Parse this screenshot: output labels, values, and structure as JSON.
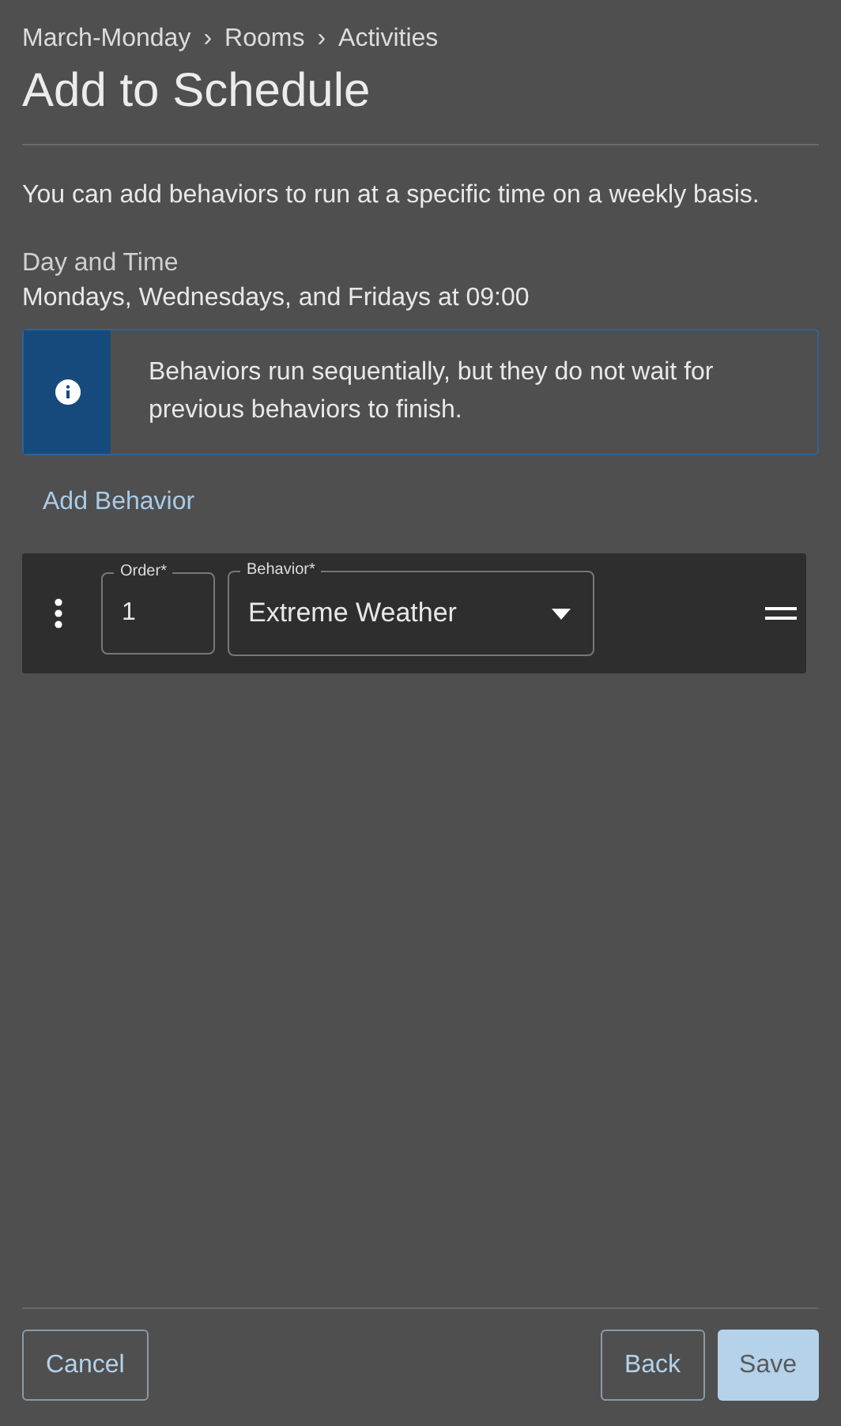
{
  "breadcrumb": [
    "March-Monday",
    "Rooms",
    "Activities"
  ],
  "breadcrumb_separator": "›",
  "title": "Add to Schedule",
  "description": "You can add behaviors to run at a specific time on a weekly basis.",
  "schedule": {
    "label": "Day and Time",
    "value": "Mondays, Wednesdays, and Fridays at 09:00"
  },
  "info_banner": {
    "text": "Behaviors run sequentially, but they do not wait for previous behaviors to finish."
  },
  "add_behavior_link": "Add Behavior",
  "behaviors": [
    {
      "order_label": "Order",
      "order_value": "1",
      "behavior_label": "Behavior",
      "behavior_value": "Extreme Weather",
      "required_mark": "*"
    }
  ],
  "footer": {
    "cancel": "Cancel",
    "back": "Back",
    "save": {
      "label": "Save",
      "disabled": true
    }
  }
}
